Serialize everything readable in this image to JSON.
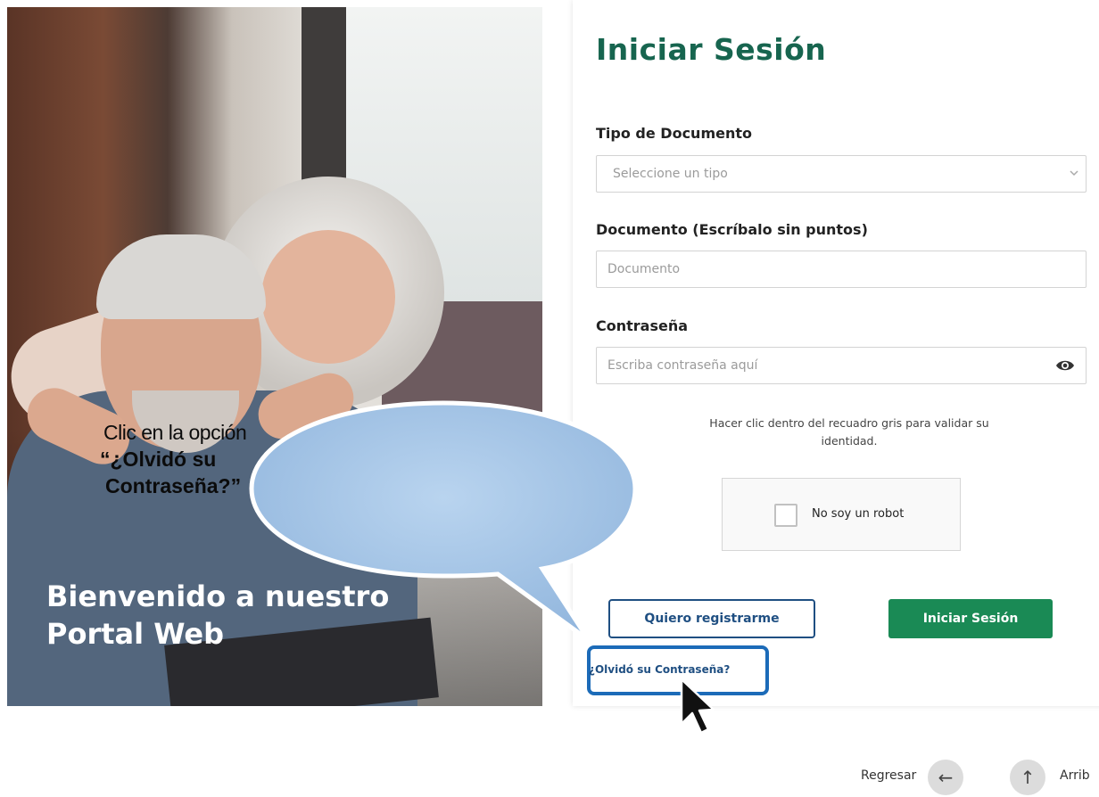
{
  "hero": {
    "title_line1": "Bienvenido a nuestro",
    "title_line2": "Portal Web"
  },
  "callout": {
    "line1": "Clic en la opción",
    "line2": "“¿Olvidó su",
    "line3": "Contraseña?”",
    "fill_color": "#a9c8e8",
    "border_color": "#ffffff"
  },
  "login": {
    "title": "Iniciar Sesión",
    "doc_type_label": "Tipo de Documento",
    "doc_type_placeholder": "Seleccione un tipo",
    "doc_label": "Documento (Escríbalo sin puntos)",
    "doc_placeholder": "Documento",
    "password_label": "Contraseña",
    "password_placeholder": "Escriba contraseña aquí",
    "hint_line1": "Hacer clic dentro del recuadro gris para validar su",
    "hint_line2": "identidad.",
    "captcha_label": "No soy un robot",
    "register_button": "Quiero registrarme",
    "login_button": "Iniciar Sesión",
    "forgot_link": "¿Olvidó su Contraseña?",
    "accent_color": "#17654f",
    "primary_button_color": "#1a8a55",
    "highlight_color": "#1c6bb8"
  },
  "footer": {
    "back_label": "Regresar",
    "up_label": "Arrib",
    "back_icon": "arrow-left-icon",
    "up_icon": "arrow-up-icon"
  }
}
